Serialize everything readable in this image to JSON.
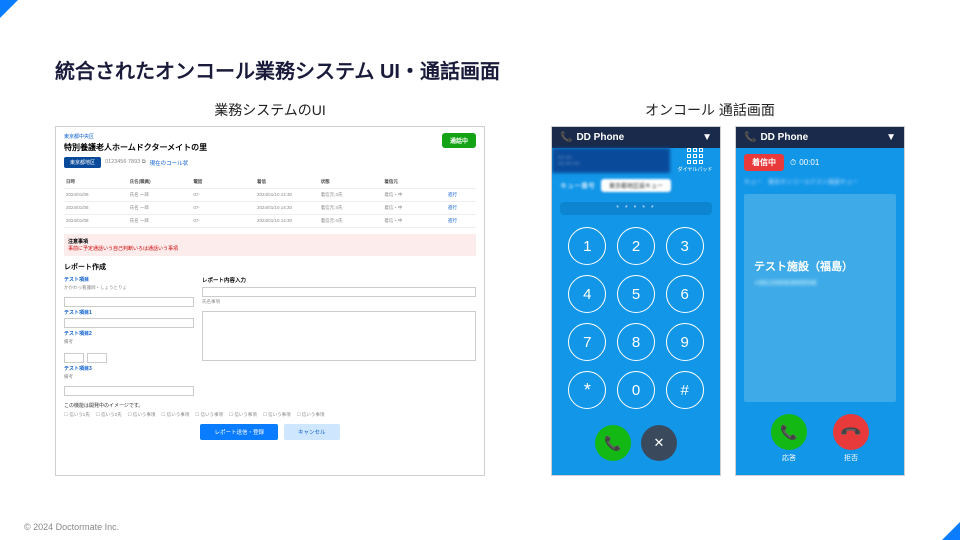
{
  "footer": "© 2024 Doctormate Inc.",
  "page_title": "統合されたオンコール業務システム UI・通話画面",
  "left": {
    "col_title": "業務システムのUI",
    "location": "東京都中央区",
    "facility_name": "特別養護老人ホームドクターメイトの里",
    "badge": "東京都地区",
    "id_text": "0123456 7893 ⧉",
    "phone_link": "現在のコール状",
    "call_button": "通話中",
    "table_headers": [
      "日時",
      "氏名(職員)",
      "電話",
      "着信",
      "状態",
      "着信元",
      ""
    ],
    "table_rows": [
      [
        "2024/01/08",
        "氏名 一郎",
        "07-",
        "2024/01/10 14:30",
        "着信元:4氏",
        "着信・中",
        "進行"
      ],
      [
        "2024/01/08",
        "氏名 一郎",
        "07-",
        "2024/01/10 14:30",
        "着信元:4氏",
        "着信・中",
        "進行"
      ],
      [
        "2024/01/08",
        "氏名 一郎",
        "07-",
        "2024/01/10 14:30",
        "着信元:4氏",
        "着信・中",
        "進行"
      ]
    ],
    "warn_title": "注意事項",
    "warn_body": "事前に予定通話いう自己判断いろは通話いう事項",
    "report_title": "レポート作成",
    "field1_t": "テスト項目",
    "field1_b": "かかわっ看護師・しょうとりょ",
    "field2_t": "テスト項目1",
    "field3_t": "テスト項目2",
    "field4_t": "テスト項目3",
    "label_right": "レポート内容入力",
    "right_b": "氏名事項",
    "note": "この機能は開発中のイメージです。",
    "checks": [
      "信いう1氏",
      "信いう2氏",
      "信いう事項",
      "信いう事項",
      "信いう事項",
      "信いう事項",
      "信いう事項",
      "信いう事項"
    ],
    "btn_primary": "レポート送信・登録",
    "btn_secondary": "キャンセル"
  },
  "right": {
    "col_title": "オンコール 通話画面",
    "phone1": {
      "header": "DD Phone",
      "dial_label": "ダイヤルパッド",
      "name_prefix": "キュー番号",
      "name_pill": "東京都地区設キュー",
      "display": "* * * * *",
      "keys": [
        "1",
        "2",
        "3",
        "4",
        "5",
        "6",
        "7",
        "8",
        "9",
        "*",
        "0",
        "#"
      ]
    },
    "phone2": {
      "header": "DD Phone",
      "incoming": "着信中",
      "timer": "00:01",
      "blur": "キュー　東京オンコールテスト施設キュー",
      "facility": "テスト施設（福島）",
      "sub": "+081339583899558",
      "answer": "応答",
      "reject": "拒否"
    }
  }
}
